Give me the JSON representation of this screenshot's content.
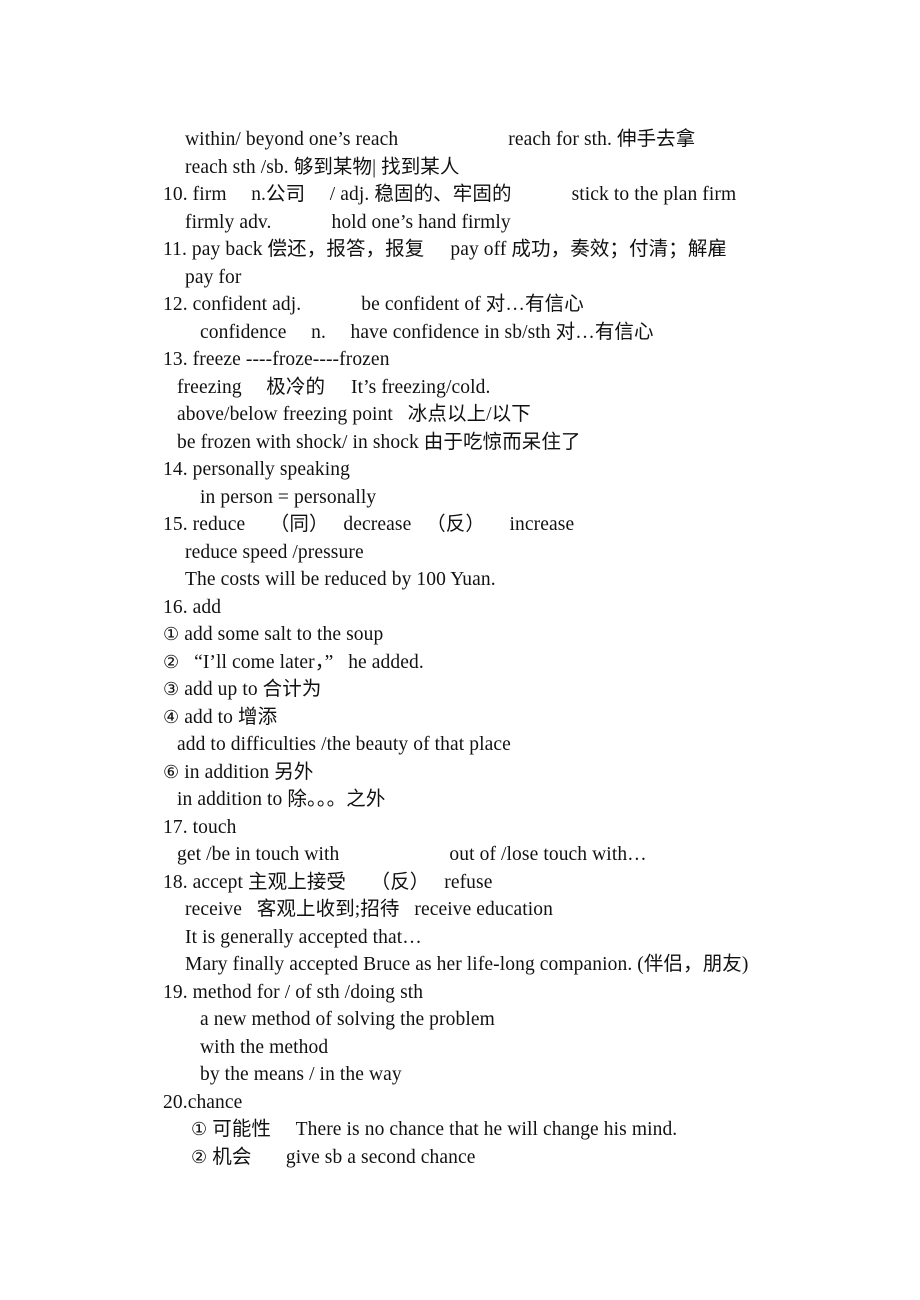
{
  "document": {
    "type": "vocabulary-study-notes",
    "language": "en-zh",
    "background_color": "#ffffff",
    "text_color": "#111111"
  },
  "lines": [
    {
      "id": "l01",
      "indent": "ind-1",
      "text": "within/ beyond one’s reach",
      "right_text": "reach for sth. 伸手去拿",
      "gap": "gap-xl"
    },
    {
      "id": "l02",
      "indent": "ind-1",
      "text": "reach sth /sb. 够到某物| 找到某人"
    },
    {
      "id": "l03",
      "indent": "ind-num",
      "marker": "10.",
      "text": " firm  n.公司  / adj. 稳固的、牢固的",
      "right_text": "stick to the plan firm",
      "gap": "gap-l"
    },
    {
      "id": "l04",
      "indent": "ind-1",
      "text": "firmly adv.",
      "right_text": "hold one’s hand firmly",
      "gap": "gap-l"
    },
    {
      "id": "l05",
      "indent": "ind-num",
      "marker": "11.",
      "text": " pay back 偿还，报答，报复",
      "right_text": "pay off 成功，奏效；付清；解雇",
      "gap": "gap-m"
    },
    {
      "id": "l06",
      "indent": "ind-1",
      "text": "pay for"
    },
    {
      "id": "l07",
      "indent": "ind-num",
      "marker": "12.",
      "text": " confident adj.",
      "right_text": "be confident of 对…有信心",
      "gap": "gap-l"
    },
    {
      "id": "l08",
      "indent": "ind-3",
      "text": "confidence  n.  have confidence in sb/sth 对…有信心"
    },
    {
      "id": "l09",
      "indent": "ind-num",
      "marker": "13.",
      "text": " freeze ----froze----frozen"
    },
    {
      "id": "l10",
      "indent": "ind-2",
      "text": "freezing  极冷的",
      "right_text": "It’s freezing/cold.",
      "gap": "gap-m"
    },
    {
      "id": "l11",
      "indent": "ind-2",
      "text": "above/below freezing point  冰点以上/以下"
    },
    {
      "id": "l12",
      "indent": "ind-2",
      "text": "be frozen with shock/ in shock 由于吃惊而呆住了"
    },
    {
      "id": "l13",
      "indent": "ind-num",
      "marker": "14.",
      "text": " personally speaking"
    },
    {
      "id": "l14",
      "indent": "ind-3",
      "text": "in person = personally"
    },
    {
      "id": "l15",
      "indent": "ind-num",
      "marker": "15.",
      "text": " reduce  （同）  decrease  （反）  increase"
    },
    {
      "id": "l16",
      "indent": "ind-1",
      "text": "reduce speed /pressure"
    },
    {
      "id": "l17",
      "indent": "ind-1",
      "text": "The costs will be reduced by 100 Yuan."
    },
    {
      "id": "l18",
      "indent": "ind-num",
      "marker": "16.",
      "text": " add"
    },
    {
      "id": "l19",
      "indent": "ind-circ",
      "marker": "①",
      "text": " add some salt to the soup"
    },
    {
      "id": "l20",
      "indent": "ind-circ",
      "marker": "②",
      "text": "  “I’ll come later，”  he added."
    },
    {
      "id": "l21",
      "indent": "ind-circ",
      "marker": "③",
      "text": " add up to 合计为"
    },
    {
      "id": "l22",
      "indent": "ind-circ",
      "marker": "④",
      "text": " add to 增添"
    },
    {
      "id": "l23",
      "indent": "ind-2",
      "text": "add to difficulties /the beauty of that place"
    },
    {
      "id": "l24",
      "indent": "ind-circ",
      "marker": "⑥",
      "text": " in addition 另外"
    },
    {
      "id": "l25",
      "indent": "ind-2",
      "text": "in addition to 除。。。之外"
    },
    {
      "id": "l26",
      "indent": "ind-num",
      "marker": "17.",
      "text": " touch"
    },
    {
      "id": "l27",
      "indent": "ind-2",
      "text": "get /be in touch with",
      "right_text": "out of /lose touch with…",
      "gap": "gap-xl"
    },
    {
      "id": "l28",
      "indent": "ind-num",
      "marker": "18.",
      "text": " accept 主观上接受  （反）  refuse"
    },
    {
      "id": "l29",
      "indent": "ind-1",
      "text": "receive  客观上收到;招待  receive education"
    },
    {
      "id": "l30",
      "indent": "ind-1",
      "text": "It is generally accepted that…"
    },
    {
      "id": "l31",
      "indent": "ind-1",
      "text": "Mary finally accepted Bruce as her life-long companion. (伴侣，朋友)"
    },
    {
      "id": "l32",
      "indent": "ind-num",
      "marker": "19.",
      "text": " method for / of sth /doing sth"
    },
    {
      "id": "l33",
      "indent": "ind-3",
      "text": "a new method of solving the problem"
    },
    {
      "id": "l34",
      "indent": "ind-3",
      "text": "with the method"
    },
    {
      "id": "l35",
      "indent": "ind-3",
      "text": "by the means / in the way"
    },
    {
      "id": "l36",
      "indent": "ind-num",
      "marker": "20.",
      "text": "chance"
    },
    {
      "id": "l37",
      "indent": "ind-circ2",
      "marker": "①",
      "text": " 可能性  There is no chance that he will change his mind."
    },
    {
      "id": "l38",
      "indent": "ind-circ2",
      "marker": "②",
      "text": " 机会   give sb a second chance"
    }
  ]
}
